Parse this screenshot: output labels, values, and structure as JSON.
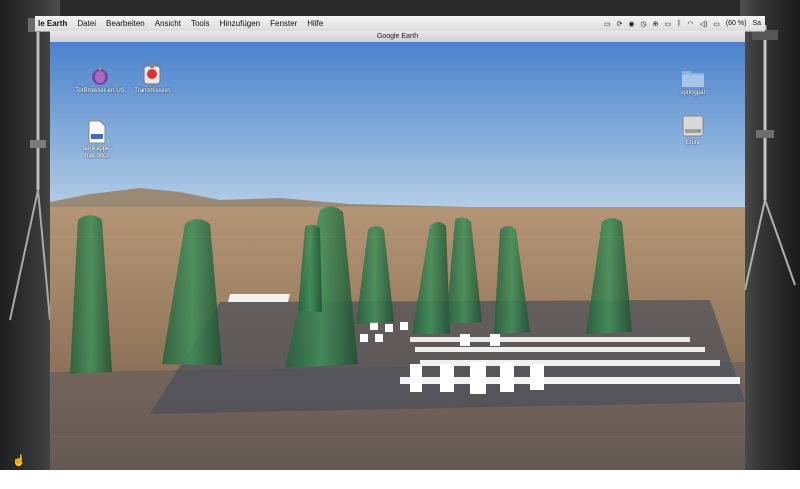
{
  "menubar": {
    "app_name": "le Earth",
    "items": [
      "Datei",
      "Bearbeiten",
      "Ansicht",
      "Tools",
      "Hinzufügen",
      "Fenster",
      "Hilfe"
    ],
    "battery": "(60 %)",
    "user": "Sa"
  },
  "window": {
    "title": "Google Earth"
  },
  "desktop_icons": {
    "tor": "TorBrowser-en-US",
    "transmission": "Transmission",
    "docx": "tarnkappe-mar.docx",
    "folder": "springpar",
    "drive": "Ehire"
  },
  "colors": {
    "sky_top": "#4f86cf",
    "sky_bottom": "#a9c6e4",
    "ground": "#a08466",
    "figures": "#2f7a4a"
  },
  "icons": [
    "apple-icon",
    "wifi-icon",
    "battery-icon",
    "bluetooth-icon",
    "volume-icon",
    "cursor-icon"
  ]
}
